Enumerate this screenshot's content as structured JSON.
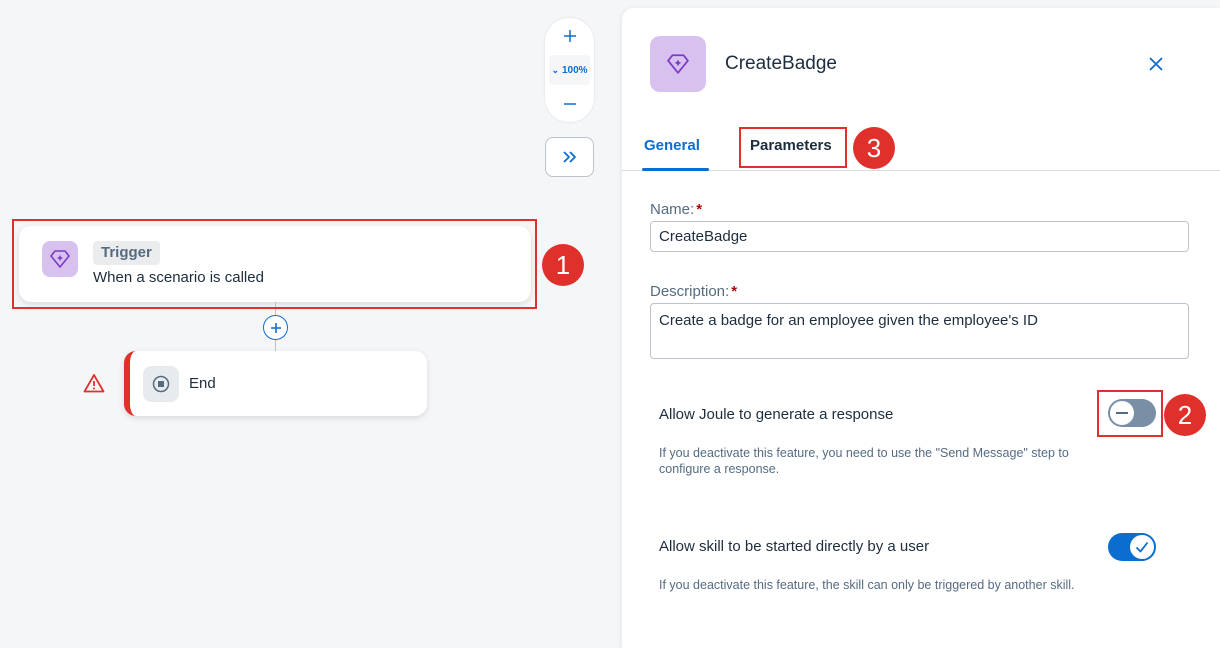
{
  "canvas": {
    "zoom": {
      "level": "100%",
      "zoom_in_icon": "plus-icon",
      "zoom_out_icon": "minus-icon",
      "expand_icon": "double-chevron-right-icon"
    },
    "trigger_node": {
      "tag": "Trigger",
      "subtitle": "When a scenario is called",
      "icon": "diamond-sparkle-icon"
    },
    "end_node": {
      "label": "End",
      "icon": "stop-circle-icon",
      "warning_icon": "warning-triangle-icon"
    },
    "add_step_icon": "plus-circle-icon"
  },
  "annotations": {
    "badge_1": "1",
    "badge_2": "2",
    "badge_3": "3"
  },
  "panel": {
    "title": "CreateBadge",
    "close_icon": "close-icon",
    "tabs": [
      {
        "label": "General",
        "active": true
      },
      {
        "label": "Parameters",
        "active": false
      }
    ],
    "name": {
      "label": "Name:",
      "required": "*",
      "value": "CreateBadge"
    },
    "description": {
      "label": "Description:",
      "required": "*",
      "value": "Create a badge for an employee given the employee's ID"
    },
    "settings": [
      {
        "title": "Allow Joule to generate a response",
        "hint": "If you deactivate this feature, you need to use the \"Send Message\" step to configure a response.",
        "enabled": false
      },
      {
        "title": "Allow skill to be started directly by a user",
        "hint": "If you deactivate this feature, the skill can only be triggered by another skill.",
        "enabled": true
      }
    ]
  },
  "colors": {
    "accent": "#0a6ed1",
    "highlight": "#e0302b",
    "icon_bg": "#d7c2ef",
    "icon_fg": "#7c3bc5"
  }
}
